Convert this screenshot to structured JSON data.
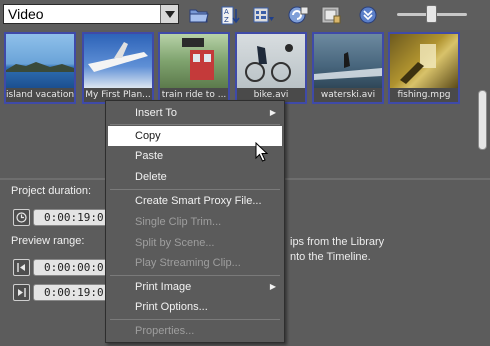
{
  "toolbar": {
    "category": "Video",
    "icons": [
      "open-folder-icon",
      "sort-icon",
      "view-options-icon",
      "import-icon",
      "library-manager-icon",
      "expand-icon"
    ]
  },
  "library": {
    "clips": [
      {
        "caption": "island vacation",
        "icon": "video-thumbnail"
      },
      {
        "caption": "My First Plan...",
        "icon": "video-thumbnail"
      },
      {
        "caption": "train ride to ...",
        "icon": "video-thumbnail"
      },
      {
        "caption": "bike.avi",
        "icon": "video-thumbnail"
      },
      {
        "caption": "waterski.avi",
        "icon": "video-thumbnail"
      },
      {
        "caption": "fishing.mpg",
        "icon": "video-thumbnail"
      }
    ],
    "zoom_level": 0.45
  },
  "project": {
    "duration_label": "Project duration:",
    "duration_value": "0:00:19:0",
    "preview_label": "Preview range:",
    "preview_start": "0:00:00:0",
    "preview_end": "0:00:19:0",
    "hint_line1": "ips from the Library",
    "hint_line2": "nto the Timeline."
  },
  "context_menu": {
    "items": [
      {
        "label": "Insert To",
        "submenu": true,
        "enabled": true,
        "highlighted": false
      },
      {
        "label": "Copy",
        "submenu": false,
        "enabled": true,
        "highlighted": true
      },
      {
        "label": "Paste",
        "submenu": false,
        "enabled": true,
        "highlighted": false
      },
      {
        "label": "Delete",
        "submenu": false,
        "enabled": true,
        "highlighted": false
      },
      {
        "label": "Create Smart Proxy File...",
        "submenu": false,
        "enabled": true,
        "highlighted": false
      },
      {
        "label": "Single Clip Trim...",
        "submenu": false,
        "enabled": false,
        "highlighted": false
      },
      {
        "label": "Split by Scene...",
        "submenu": false,
        "enabled": false,
        "highlighted": false
      },
      {
        "label": "Play Streaming Clip...",
        "submenu": false,
        "enabled": false,
        "highlighted": false
      },
      {
        "label": "Print Image",
        "submenu": true,
        "enabled": true,
        "highlighted": false
      },
      {
        "label": "Print Options...",
        "submenu": false,
        "enabled": true,
        "highlighted": false
      },
      {
        "label": "Properties...",
        "submenu": false,
        "enabled": false,
        "highlighted": false
      }
    ]
  },
  "colors": {
    "panel": "#5c5c5c",
    "selection_border": "#3f4aa8",
    "menu_highlight": "#ffffff"
  }
}
